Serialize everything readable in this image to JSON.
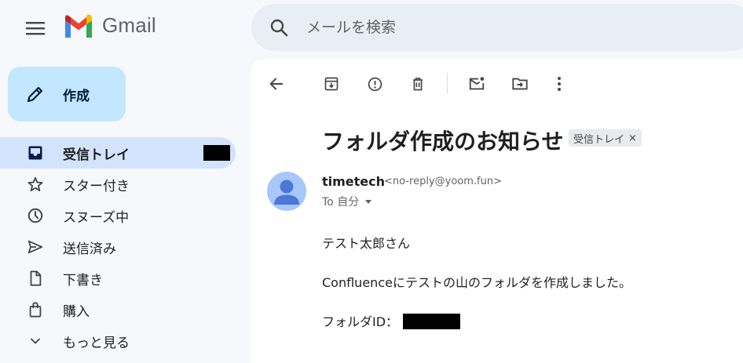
{
  "header": {
    "app_name": "Gmail",
    "search_placeholder": "メールを検索"
  },
  "compose": {
    "label": "作成"
  },
  "sidebar": {
    "items": [
      {
        "label": "受信トレイ",
        "icon": "inbox-icon",
        "active": true
      },
      {
        "label": "スター付き",
        "icon": "star-icon"
      },
      {
        "label": "スヌーズ中",
        "icon": "clock-icon"
      },
      {
        "label": "送信済み",
        "icon": "send-icon"
      },
      {
        "label": "下書き",
        "icon": "draft-icon"
      },
      {
        "label": "購入",
        "icon": "shopping-bag-icon"
      },
      {
        "label": "もっと見る",
        "icon": "chevron-down-icon"
      }
    ]
  },
  "toolbar": {
    "icons": [
      "back-arrow-icon",
      "archive-icon",
      "report-spam-icon",
      "delete-icon",
      "mark-unread-icon",
      "move-to-icon",
      "more-vert-icon"
    ]
  },
  "message": {
    "subject": "フォルダ作成のお知らせ",
    "label_chip": "受信トレイ",
    "label_chip_close": "×",
    "sender_name": "timetech",
    "sender_email": "<no-reply@yoom.fun>",
    "to": "To 自分",
    "body": {
      "greeting": "テスト太郎さん",
      "line1": "Confluenceにテストの山のフォルダを作成しました。",
      "folder_id_label": "フォルダID："
    }
  },
  "colors": {
    "accent_compose": "#c2e7ff",
    "active_nav": "#d3e3fd",
    "background": "#f6f8fc",
    "search_bg": "#e9eef6"
  }
}
